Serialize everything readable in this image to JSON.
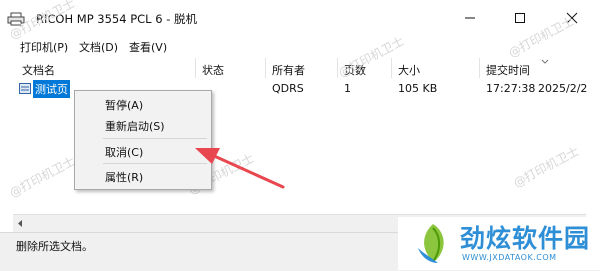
{
  "window": {
    "title": "RICOH MP 3554 PCL 6 - 脱机",
    "buttons": {
      "minimize": "minimize",
      "maximize": "maximize",
      "close": "close"
    }
  },
  "menu": [
    "打印机(P)",
    "文档(D)",
    "查看(V)"
  ],
  "columns": [
    "文档名",
    "状态",
    "所有者",
    "页数",
    "大小",
    "提交时间"
  ],
  "row": {
    "name": "测试页",
    "status": "",
    "owner": "QDRS",
    "pages": "1",
    "size": "105 KB",
    "time": "17:27:38",
    "date": "2025/2/2"
  },
  "context_menu": {
    "pause": "暂停(A)",
    "restart": "重新启动(S)",
    "cancel": "取消(C)",
    "properties": "属性(R)"
  },
  "status_text": "删除所选文档。",
  "watermark": "@打印机卫士",
  "logo": {
    "name": "劲炫软件园",
    "url": "WWW.JXDATAOK.COM"
  },
  "colors": {
    "selection": "#0078d7",
    "arrow": "#e8474f",
    "logo": "#2f8fd6"
  }
}
